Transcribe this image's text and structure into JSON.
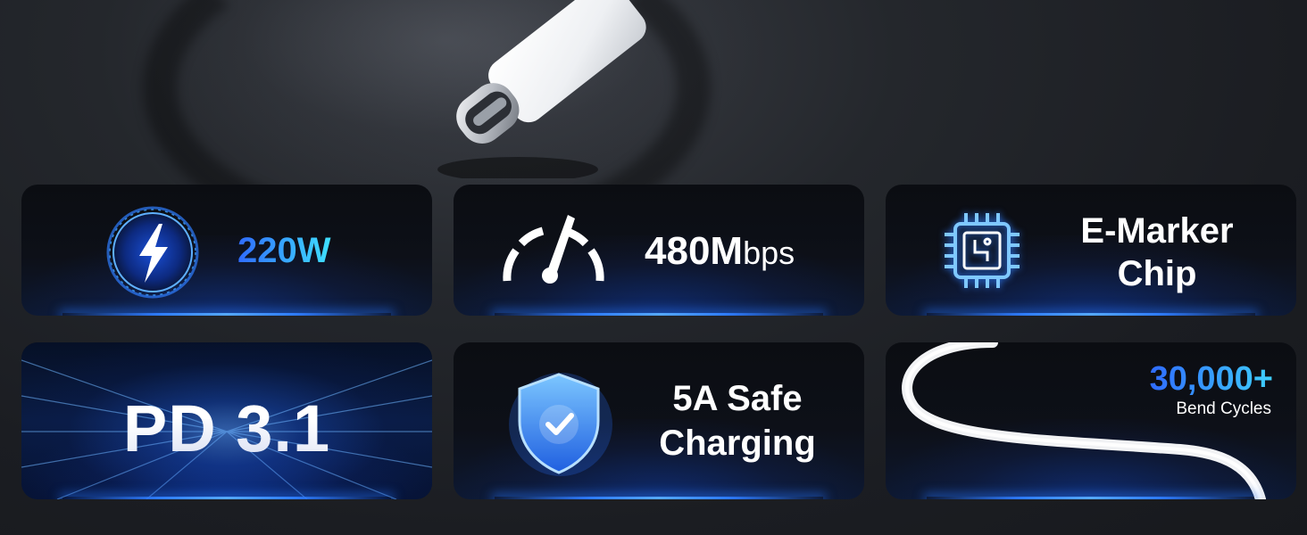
{
  "hero": {
    "icon": "usb-c-connector-icon"
  },
  "features": {
    "power": {
      "value": "220W",
      "icon": "lightning-bolt-icon"
    },
    "speed": {
      "value": "480M",
      "unit": "bps",
      "icon": "speedometer-icon"
    },
    "chip": {
      "line1": "E-Marker",
      "line2": "Chip",
      "icon": "chip-icon"
    },
    "pd": {
      "value": "PD 3.1"
    },
    "safety": {
      "line1": "5A Safe",
      "line2": "Charging",
      "icon": "shield-check-icon"
    },
    "durability": {
      "value": "30,000+",
      "label": "Bend Cycles",
      "icon": "cable-loop-icon"
    }
  },
  "colors": {
    "accent_blue": "#2f7dff",
    "cyan": "#3fd0ff",
    "card_bg": "#0b0d12"
  }
}
